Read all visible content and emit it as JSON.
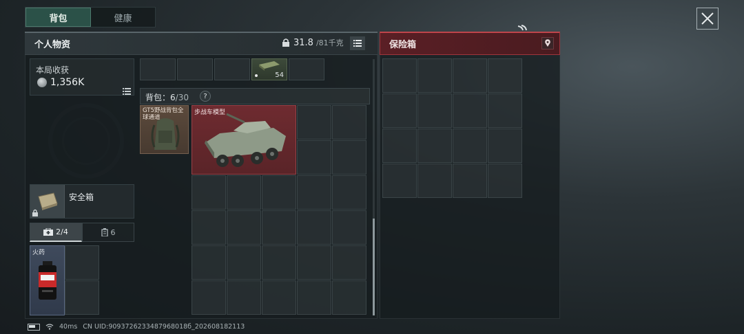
{
  "tabs": [
    {
      "label": "背包",
      "active": true
    },
    {
      "label": "健康",
      "active": false
    }
  ],
  "inventory": {
    "title": "个人物资",
    "weight_current": "31.8",
    "weight_max": "/81千克"
  },
  "insurance": {
    "title": "保险箱"
  },
  "earnings": {
    "label": "本局收获",
    "value": "1,356K"
  },
  "secure_case": {
    "label": "安全箱",
    "tab_equip": "2/4",
    "tab_count": "6",
    "item_label": "火药"
  },
  "top_row": {
    "ammo_count": "54"
  },
  "backpack": {
    "label_prefix": "背包：",
    "used": "6",
    "capacity": "/30",
    "help": "?",
    "bag_item_label": "GT5野战背包全球通道",
    "vehicle_item_label": "步战车模型"
  },
  "status_bar": {
    "ping": "40ms",
    "uid": "CN UID:9093726233487968018б_202608182113"
  },
  "colors": {
    "accent_green": "#2b5148",
    "insurance_red": "#a0353c",
    "vehicle_item_bg": "#6e2b30"
  }
}
